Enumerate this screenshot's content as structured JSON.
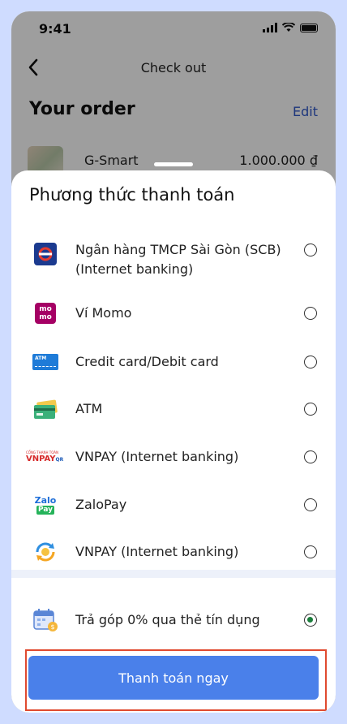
{
  "status_bar": {
    "time": "9:41"
  },
  "header": {
    "back_icon": "chevron-left-icon",
    "title": "Check out"
  },
  "order": {
    "title": "Your order",
    "edit_label": "Edit",
    "item": {
      "name": "G-Smart",
      "price": "1.000.000 ₫"
    }
  },
  "sheet": {
    "title": "Phương thức thanh toán",
    "options": [
      {
        "label": "Ngân hàng TMCP Sài Gòn (SCB) (Internet banking)",
        "icon": "scb-bank-icon",
        "selected": false
      },
      {
        "label": "Ví Momo",
        "icon": "momo-icon",
        "selected": false
      },
      {
        "label": "Credit card/Debit card",
        "icon": "credit-card-icon",
        "selected": false
      },
      {
        "label": "ATM",
        "icon": "atm-card-icon",
        "selected": false
      },
      {
        "label": "VNPAY (Internet banking)",
        "icon": "vnpay-icon",
        "selected": false
      },
      {
        "label": "ZaloPay",
        "icon": "zalopay-icon",
        "selected": false
      },
      {
        "label": "VNPAY (Internet banking)",
        "icon": "vnpay-exchange-icon",
        "selected": false
      }
    ],
    "installment": {
      "label": "Trả góp 0% qua thẻ tín dụng",
      "icon": "calendar-coin-icon",
      "selected": true
    },
    "cta_label": "Thanh toán ngay",
    "vnpay_logo_small": "CỔNG THANH TOÁN",
    "vnpay_logo_main": "VNPAY",
    "vnpay_logo_qr": "QR",
    "momo_logo": "mo mo",
    "zalo_logo_top": "Zalo",
    "zalo_logo_bottom": "Pay",
    "atm_chip_text": "ATM"
  },
  "colors": {
    "accent": "#4a80ea",
    "highlight_border": "#e04a2f",
    "radio_selected": "#1b7d3c",
    "edit_link": "#2f57c8",
    "page_background": "#cfdcff"
  }
}
